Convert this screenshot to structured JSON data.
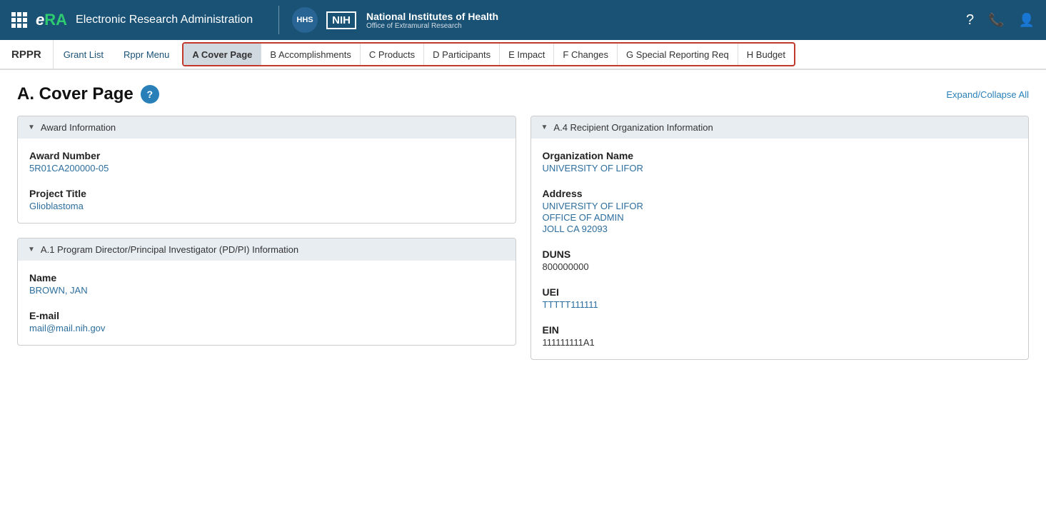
{
  "header": {
    "grid_label": "menu",
    "era_e": "e",
    "era_ra": "RA",
    "app_title": "Electronic Research Administration",
    "nih_badge": "NIH",
    "nih_main": "National Institutes of Health",
    "nih_sub": "Office of Extramural Research",
    "help_icon": "?",
    "phone_icon": "📞",
    "user_icon": "👤"
  },
  "nav": {
    "rppr_label": "RPPR",
    "grant_list": "Grant List",
    "rppr_menu": "Rppr Menu"
  },
  "tabs": [
    {
      "id": "a",
      "label": "A Cover Page",
      "active": true
    },
    {
      "id": "b",
      "label": "B Accomplishments",
      "active": false
    },
    {
      "id": "c",
      "label": "C Products",
      "active": false
    },
    {
      "id": "d",
      "label": "D Participants",
      "active": false
    },
    {
      "id": "e",
      "label": "E Impact",
      "active": false
    },
    {
      "id": "f",
      "label": "F Changes",
      "active": false
    },
    {
      "id": "g",
      "label": "G Special Reporting Req",
      "active": false
    },
    {
      "id": "h",
      "label": "H Budget",
      "active": false
    }
  ],
  "page": {
    "title": "A. Cover Page",
    "expand_collapse": "Expand/Collapse All"
  },
  "award_section": {
    "header": "Award Information",
    "award_number_label": "Award Number",
    "award_number_value": "5R01CA200000-05",
    "project_title_label": "Project Title",
    "project_title_value": "Glioblastoma"
  },
  "pi_section": {
    "header": "A.1 Program Director/Principal Investigator (PD/PI) Information",
    "name_label": "Name",
    "name_value": "BROWN, JAN",
    "email_label": "E-mail",
    "email_value": "mail@mail.nih.gov"
  },
  "org_section": {
    "header": "A.4 Recipient Organization Information",
    "org_name_label": "Organization Name",
    "org_name_value": "UNIVERSITY OF LIFOR",
    "address_label": "Address",
    "address_line1": "UNIVERSITY OF LIFOR",
    "address_line2": "OFFICE OF ADMIN",
    "address_line3": "JOLL CA 92093",
    "duns_label": "DUNS",
    "duns_value": "800000000",
    "uei_label": "UEI",
    "uei_value": "TTTTT111111",
    "ein_label": "EIN",
    "ein_value": "111111111A1"
  }
}
